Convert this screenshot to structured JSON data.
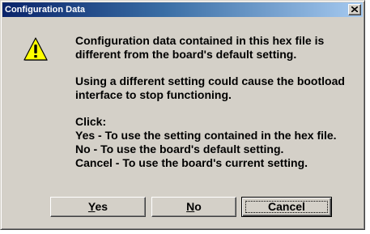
{
  "window": {
    "title": "Configuration Data"
  },
  "icon": {
    "name": "warning-icon",
    "fill": "#ffff00",
    "stroke": "#000000"
  },
  "message": {
    "paragraph1": "Configuration data contained in this hex file is different from the board's default setting.",
    "paragraph2": "Using a different setting could cause the bootload interface to stop functioning.",
    "click_label": "Click:",
    "option_yes": "Yes - To use the setting contained in the hex file.",
    "option_no": "No - To use the board's default setting.",
    "option_cancel": "Cancel - To use the board's current setting."
  },
  "buttons": {
    "yes": {
      "mnemonic": "Y",
      "rest": "es"
    },
    "no": {
      "mnemonic": "N",
      "rest": "o"
    },
    "cancel": "Cancel"
  },
  "colors": {
    "title_start": "#0a246a",
    "title_end": "#a6caf0",
    "face": "#d4d0c8"
  }
}
